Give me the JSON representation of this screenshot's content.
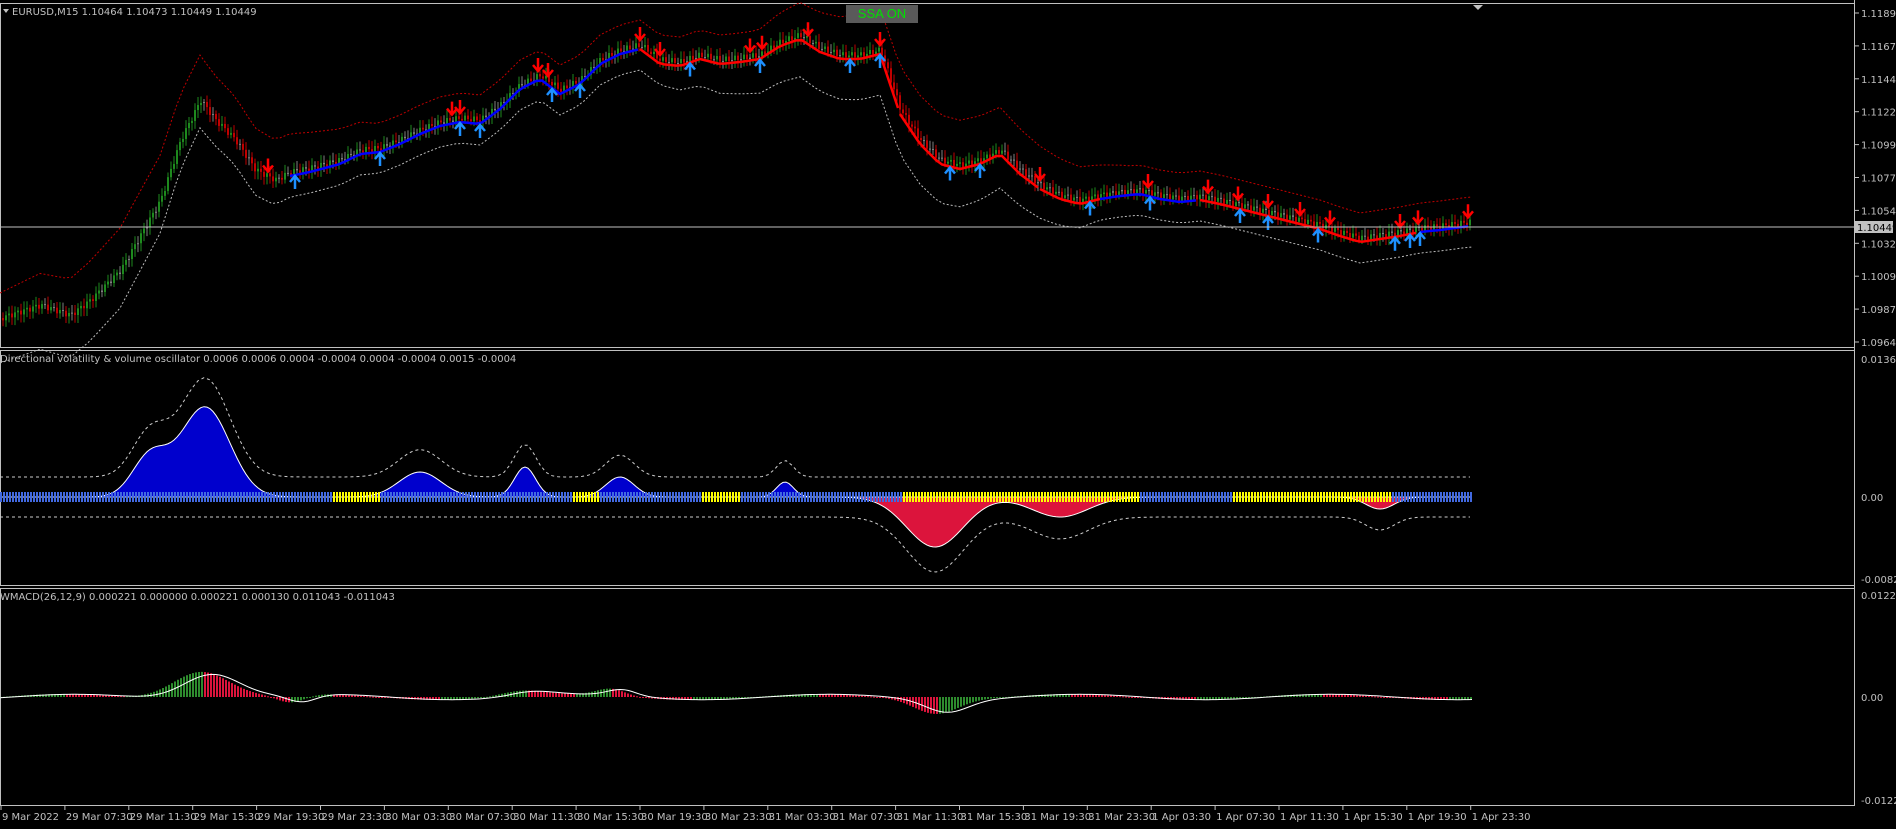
{
  "header": {
    "symbol_info": "EURUSD,M15  1.10464 1.10473 1.10449 1.10449",
    "ssa_button": "SSA ON"
  },
  "price_panel": {
    "price_ticks": [
      "1.11895",
      "1.11670",
      "1.11445",
      "1.11220",
      "1.10995",
      "1.10770",
      "1.10545",
      "1.10320",
      "1.10095",
      "1.09870",
      "1.09645"
    ],
    "current_price": "1.10449",
    "colors": {
      "up": "#1e8a1e",
      "down": "#c00000",
      "neutral": "#7f7f7f",
      "ssa_blue": "#0000ff",
      "ssa_red": "#ff0000",
      "buy_arrow": "#1e90ff",
      "sell_arrow": "#ff0000"
    }
  },
  "osc_panel": {
    "label": "Directional volatility & volume oscillator 0.0006 0.0006 0.0004 -0.0004 0.0004 -0.0004 0.0015 -0.0004",
    "ticks": [
      "0.0136",
      "0.00",
      "-0.0082"
    ],
    "colors": {
      "positive": "#0000cd",
      "negative": "#dc143c",
      "bar_blue": "#4169e1",
      "bar_yellow": "#ffff00"
    }
  },
  "macd_panel": {
    "label": "WMACD(26,12,9) 0.000221 0.000000 0.000221 0.000130 0.011043 -0.011043",
    "ticks": [
      "0.012285",
      "0.00",
      "-0.012285"
    ],
    "colors": {
      "up": "#2e8b2e",
      "down": "#dc143c",
      "signal": "#ffffff"
    }
  },
  "time_axis": [
    "9 Mar 2022",
    "29 Mar 07:30",
    "29 Mar 11:30",
    "29 Mar 15:30",
    "29 Mar 19:30",
    "29 Mar 23:30",
    "30 Mar 03:30",
    "30 Mar 07:30",
    "30 Mar 11:30",
    "30 Mar 15:30",
    "30 Mar 19:30",
    "30 Mar 23:30",
    "31 Mar 03:30",
    "31 Mar 07:30",
    "31 Mar 11:30",
    "31 Mar 15:30",
    "31 Mar 19:30",
    "31 Mar 23:30",
    "1 Apr 03:30",
    "1 Apr 07:30",
    "1 Apr 11:30",
    "1 Apr 15:30",
    "1 Apr 19:30",
    "1 Apr 23:30"
  ]
}
